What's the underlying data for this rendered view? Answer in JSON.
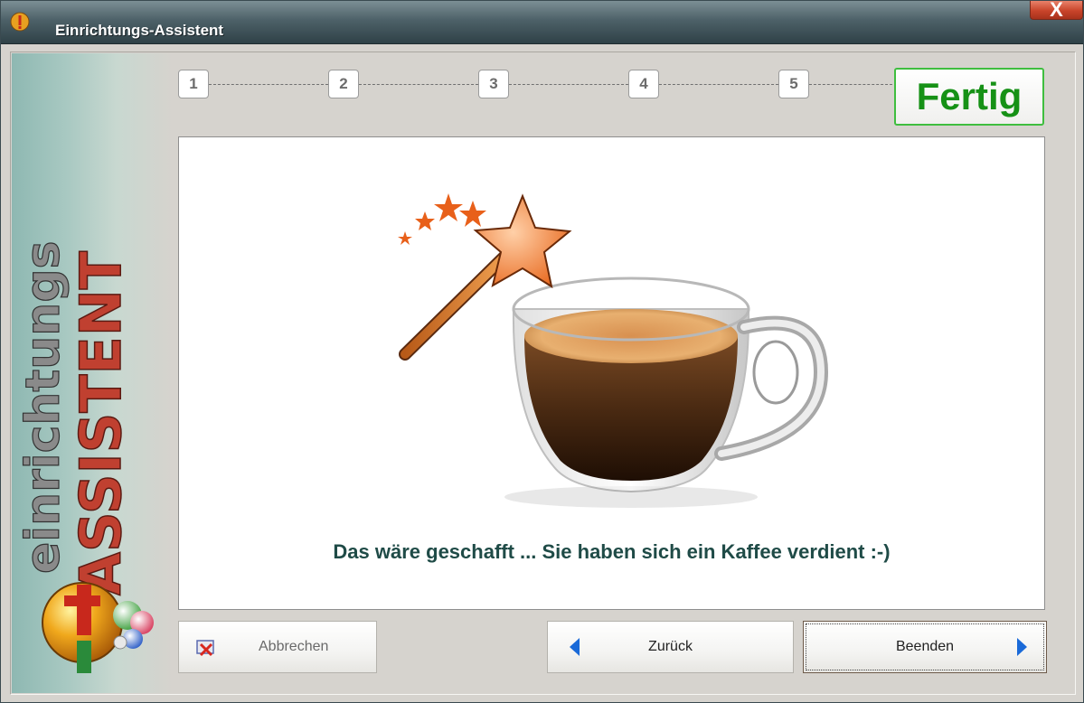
{
  "window": {
    "title": "Einrichtungs-Assistent",
    "close_label": "X"
  },
  "sidebar": {
    "logo_text_top": "ASSISTENT",
    "logo_text_bottom": "einrichtungs"
  },
  "steps": [
    {
      "number": "1"
    },
    {
      "number": "2"
    },
    {
      "number": "3"
    },
    {
      "number": "4"
    },
    {
      "number": "5"
    }
  ],
  "final_step_label": "Fertig",
  "content": {
    "message": "Das wäre geschafft ... Sie haben sich ein Kaffee verdient :-)"
  },
  "buttons": {
    "cancel": "Abbrechen",
    "back": "Zurück",
    "finish": "Beenden"
  },
  "colors": {
    "titlebar": "#4d6168",
    "done_green": "#169116",
    "message_teal": "#1f4b47",
    "arrow_blue": "#1a6ad8"
  }
}
